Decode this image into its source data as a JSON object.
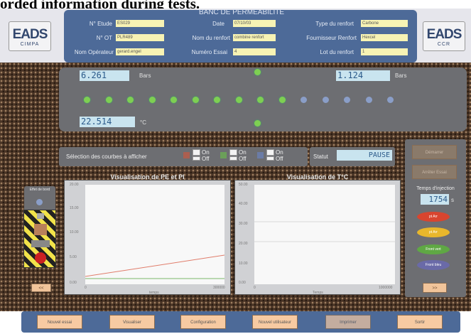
{
  "caption": "orded information during tests.",
  "app": {
    "title": "BANC DE PERMEABILITE"
  },
  "logos": {
    "left": {
      "brand": "EADS",
      "sub": "CIMPA"
    },
    "right": {
      "brand": "EADS",
      "sub": "CCR"
    }
  },
  "fields": {
    "col1": [
      {
        "label": "N° Etude",
        "value": "ES029"
      },
      {
        "label": "N° OT",
        "value": "PLR489"
      },
      {
        "label": "Nom Opérateur",
        "value": "gerard.engel"
      }
    ],
    "col2": [
      {
        "label": "Date",
        "value": "07/10/03"
      },
      {
        "label": "Nom du renfort",
        "value": "combine renfort"
      },
      {
        "label": "Numéro Essai",
        "value": "4"
      }
    ],
    "col3": [
      {
        "label": "Type du renfort",
        "value": "Carbone"
      },
      {
        "label": "Fournisseur Renfort",
        "value": "Hexcel"
      },
      {
        "label": "Lot du renfort",
        "value": "1"
      }
    ]
  },
  "sensors": {
    "pe": {
      "value": "6.261",
      "unit": "Bars"
    },
    "pi": {
      "value": "1.124",
      "unit": "Bars"
    },
    "temp": {
      "value": "22.514",
      "unit": "°C"
    },
    "dots": [
      "green",
      "green",
      "green",
      "green",
      "green",
      "green",
      "green",
      "green",
      "green",
      "green",
      "blue",
      "blue",
      "blue",
      "blue",
      "blue"
    ]
  },
  "selection": {
    "label": "Sélection des courbes à afficher",
    "groups": [
      {
        "color": "#d5553b",
        "on": "On",
        "off": "Off"
      },
      {
        "color": "#6bc04a",
        "on": "On",
        "off": "Off"
      },
      {
        "color": "#6a86c9",
        "on": "On",
        "off": "Off"
      }
    ],
    "status_label": "Statut",
    "status_value": "PAUSE"
  },
  "charts": {
    "left": {
      "title": "Visualisation de PE et PI",
      "yticks": [
        "20.00",
        "15.00",
        "10.00",
        "5.00",
        "0.00"
      ],
      "xticks": [
        "0",
        "",
        "300000"
      ],
      "xlabel": "temps"
    },
    "right": {
      "title": "Visualisation de T°C",
      "yticks": [
        "50.00",
        "40.00",
        "30.00",
        "20.00",
        "10.00",
        "0.00"
      ],
      "xticks": [
        "0",
        "1000000"
      ],
      "xlabel": "Temps"
    }
  },
  "left_controls": {
    "effet_label": "Effet de bord",
    "back_label": "<<"
  },
  "right_controls": {
    "top_button": "Démarrer",
    "second_button": "Arrêter Essai",
    "temps_label": "Temps d'injection",
    "temps_value": "1754",
    "temps_unit": "s",
    "ovals": [
      {
        "label": "pt Arr",
        "color": "#d8452f"
      },
      {
        "label": "pt Arr",
        "color": "#e8b72c"
      },
      {
        "label": "Front vert",
        "color": "#5fa844"
      },
      {
        "label": "Front bleu",
        "color": "#6a6aa8"
      }
    ],
    "forward_label": ">>"
  },
  "bottom_buttons": [
    "Nouvel essai",
    "Visualiser",
    "Configuration",
    "Nouvel utilisateur",
    "Imprimer",
    "Sortir"
  ]
}
